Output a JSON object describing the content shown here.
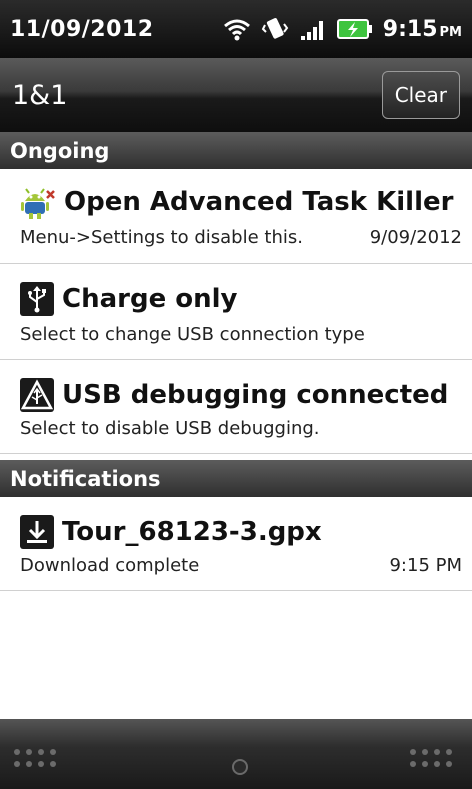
{
  "status_bar": {
    "date": "11/09/2012",
    "time": "9:15",
    "ampm": "PM",
    "icons": [
      "wifi-icon",
      "vibrate-icon",
      "signal-icon",
      "battery-charging-icon"
    ]
  },
  "header": {
    "carrier": "1&1",
    "clear_label": "Clear"
  },
  "sections": {
    "ongoing": "Ongoing",
    "notifications": "Notifications"
  },
  "ongoing_items": [
    {
      "icon": "android-task-killer-icon",
      "title": "Open Advanced Task Killer",
      "subtitle": "Menu->Settings to disable this.",
      "time": "9/09/2012"
    },
    {
      "icon": "usb-icon",
      "title": "Charge only",
      "subtitle": "Select to change USB connection type"
    },
    {
      "icon": "warning-icon",
      "title": "USB debugging connected",
      "subtitle": "Select to disable USB debugging."
    }
  ],
  "notification_items": [
    {
      "icon": "download-icon",
      "title": "Tour_68123-3.gpx",
      "subtitle": "Download complete",
      "time": "9:15 PM"
    }
  ],
  "colors": {
    "status_bar": "#0c0c0c",
    "section_header": "#3f3f3f",
    "row_divider": "#d0d0d0",
    "battery_fill": "#3ec43e"
  }
}
